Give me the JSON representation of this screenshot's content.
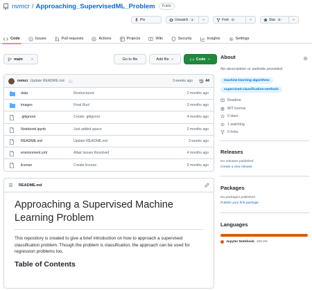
{
  "repo": {
    "owner": "nvmcr",
    "separator": "/",
    "name": "Approaching_SupervisedML_Problem",
    "visibility": "Public"
  },
  "actions": {
    "pin_label": "Pin",
    "unwatch_label": "Unwatch",
    "unwatch_count": "1",
    "fork_label": "Fork",
    "fork_count": "0",
    "star_label": "Star",
    "star_count": "0"
  },
  "tabs": [
    {
      "label": "Code",
      "icon": "code-icon"
    },
    {
      "label": "Issues",
      "icon": "issue-icon"
    },
    {
      "label": "Pull requests",
      "icon": "pull-request-icon"
    },
    {
      "label": "Actions",
      "icon": "play-icon"
    },
    {
      "label": "Projects",
      "icon": "table-icon"
    },
    {
      "label": "Wiki",
      "icon": "book-icon"
    },
    {
      "label": "Security",
      "icon": "shield-icon"
    },
    {
      "label": "Insights",
      "icon": "graph-icon"
    },
    {
      "label": "Settings",
      "icon": "gear-icon"
    }
  ],
  "toolbar": {
    "branch": "main",
    "goto_file": "Go to file",
    "add_file": "Add file",
    "code": "Code"
  },
  "commit": {
    "user": "nvmcr",
    "message": "Update README.md",
    "ellipsis": "...",
    "time": "3 weeks ago",
    "count": "44"
  },
  "files": [
    {
      "name": "data",
      "type": "folder",
      "message": "Restructured",
      "time": "2 months ago"
    },
    {
      "name": "images",
      "type": "folder",
      "message": "Final Run!",
      "time": "3 months ago"
    },
    {
      "name": ".gitignore",
      "type": "file",
      "message": "Create .gitignore",
      "time": "4 months ago"
    },
    {
      "name": "Notebook.ipynb",
      "type": "file",
      "message": "Just added space",
      "time": "2 months ago"
    },
    {
      "name": "README.md",
      "type": "file",
      "message": "Update README.md",
      "time": "3 weeks ago"
    },
    {
      "name": "environment.yml",
      "type": "file",
      "message": "Altair Issues Resolved",
      "time": "4 months ago"
    },
    {
      "name": "license",
      "type": "file",
      "message": "Create license",
      "time": "3 months ago"
    }
  ],
  "readme": {
    "filename": "README.md",
    "title": "Approaching a Supervised Machine Learning Problem",
    "paragraph": "This repository is created to give a brief introduction on how to approach a supervised classification problem. Though the problem is classification, the approach can be used for regression problems too.",
    "toc_heading": "Table of Contents"
  },
  "about": {
    "heading": "About",
    "description": "No description or website provided.",
    "topics": [
      "machine-learning-algorithms",
      "supervised-classification-methods"
    ],
    "meta": [
      {
        "icon": "book-icon",
        "label": "Readme"
      },
      {
        "icon": "law-icon",
        "label": "MIT license"
      },
      {
        "icon": "star-icon",
        "label": "0 stars"
      },
      {
        "icon": "eye-icon",
        "label": "1 watching"
      },
      {
        "icon": "fork-icon",
        "label": "0 forks"
      }
    ]
  },
  "releases": {
    "heading": "Releases",
    "empty": "No releases published",
    "link": "Create a new release"
  },
  "packages": {
    "heading": "Packages",
    "empty": "No packages published",
    "link": "Publish your first package"
  },
  "languages": {
    "heading": "Languages",
    "items": [
      {
        "name": "Jupyter Notebook",
        "percent": "100.0%",
        "fraction": 1.0,
        "color": "#DA5B0B"
      }
    ]
  },
  "colors": {
    "link": "#0969da",
    "primary_button": "#1f883d",
    "active_tab_underline": "#fd8c73",
    "folder": "#54aeff",
    "topic_bg": "#ddf4ff"
  }
}
